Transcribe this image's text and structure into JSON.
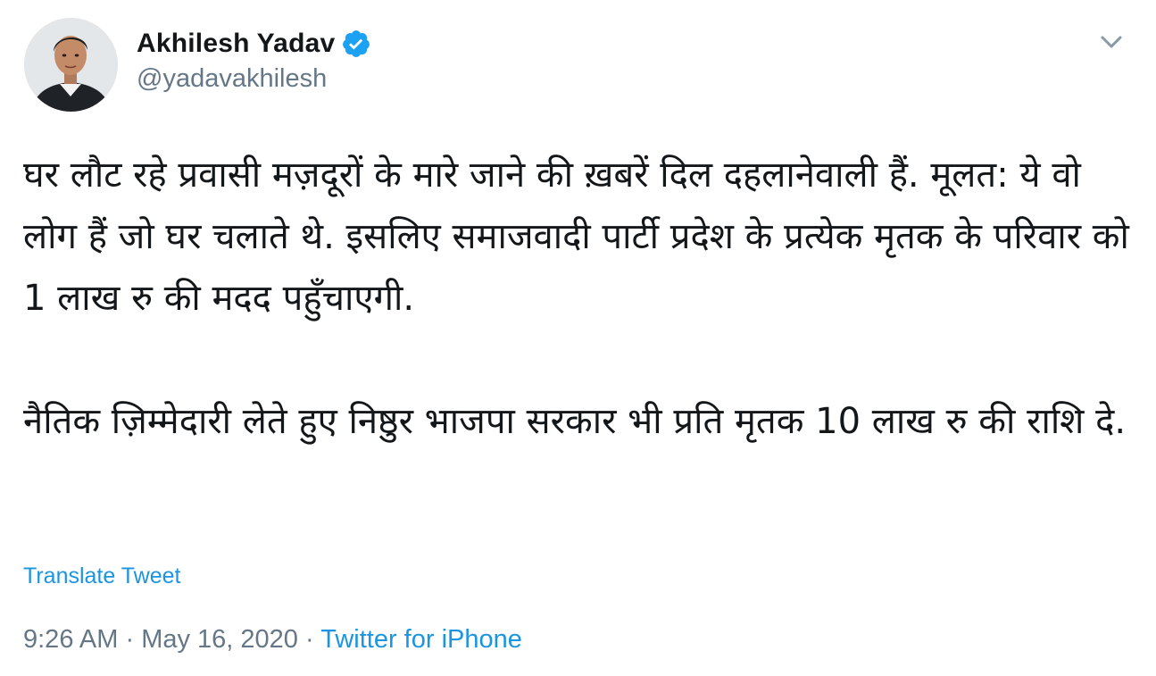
{
  "tweet": {
    "author": {
      "display_name": "Akhilesh Yadav",
      "handle": "@yadavakhilesh",
      "verified": true
    },
    "text_paragraphs": [
      "घर लौट रहे प्रवासी मज़दूरों के मारे जाने की ख़बरें दिल दहलानेवाली हैं. मूलत: ये वो लोग हैं जो घर चलाते थे. इसलिए समाजवादी पार्टी प्रदेश के प्रत्येक मृतक के परिवार को 1 लाख रु की मदद पहुँचाएगी.",
      "नैतिक ज़िम्मेदारी लेते हुए निष्ठुर भाजपा सरकार भी प्रति मृतक 10 लाख रु की राशि दे."
    ],
    "translate_label": "Translate Tweet",
    "time": "9:26 AM",
    "date": "May 16, 2020",
    "separator": "·",
    "source": "Twitter for iPhone"
  },
  "icons": {
    "verified": "verified-badge-icon",
    "caret": "chevron-down-icon",
    "avatar": "avatar-photo"
  },
  "colors": {
    "link": "#1b95e0",
    "secondary_text": "#657786",
    "primary_text": "#14171a",
    "verified": "#1da1f2"
  }
}
